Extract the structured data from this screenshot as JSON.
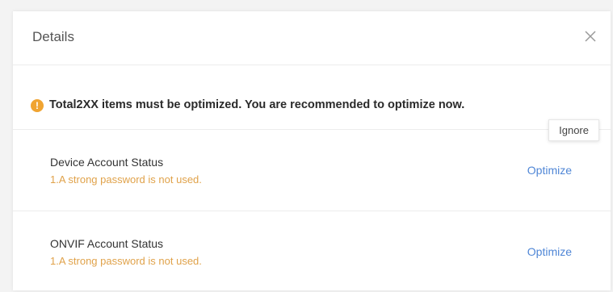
{
  "dialog": {
    "title": "Details",
    "close_icon": "close-icon"
  },
  "banner": {
    "icon": "warning-icon",
    "icon_glyph": "!",
    "text": "Total2XX items must be optimized. You are recommended to optimize now.",
    "ignore_label": "Ignore"
  },
  "items": [
    {
      "title": "Device Account Status",
      "subtitle": "1.A strong password is not used.",
      "action": "Optimize"
    },
    {
      "title": "ONVIF Account Status",
      "subtitle": "1.A strong password is not used.",
      "action": "Optimize"
    }
  ],
  "colors": {
    "warning": "#f0a431",
    "subtitle": "#e0a24a",
    "link": "#4f86d6"
  }
}
